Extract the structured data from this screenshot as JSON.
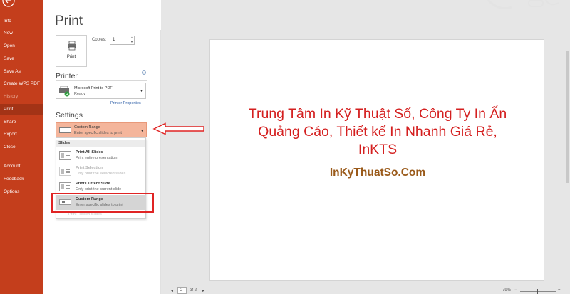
{
  "sidebar": {
    "items": [
      {
        "label": "Info",
        "state": "normal"
      },
      {
        "label": "New",
        "state": "normal"
      },
      {
        "label": "Open",
        "state": "normal"
      },
      {
        "label": "Save",
        "state": "normal"
      },
      {
        "label": "Save As",
        "state": "normal"
      },
      {
        "label": "Create WPS PDF",
        "state": "normal"
      },
      {
        "label": "History",
        "state": "dim"
      },
      {
        "label": "Print",
        "state": "selected"
      },
      {
        "label": "Share",
        "state": "normal"
      },
      {
        "label": "Export",
        "state": "normal"
      },
      {
        "label": "Close",
        "state": "normal"
      },
      {
        "label": "Account",
        "state": "normal"
      },
      {
        "label": "Feedback",
        "state": "normal"
      },
      {
        "label": "Options",
        "state": "normal"
      }
    ]
  },
  "page": {
    "title": "Print"
  },
  "print": {
    "button_label": "Print",
    "copies_label": "Copies:",
    "copies_value": "1"
  },
  "printer": {
    "heading": "Printer",
    "name": "Microsoft Print to PDF",
    "status": "Ready",
    "properties_link": "Printer Properties"
  },
  "settings": {
    "heading": "Settings",
    "selected": {
      "title": "Custom Range",
      "desc": "Enter specific slides to print"
    },
    "dropdown": {
      "header": "Slides",
      "items": [
        {
          "title": "Print All Slides",
          "desc": "Print entire presentation",
          "state": "normal"
        },
        {
          "title": "Print Selection",
          "desc": "Only print the selected slides",
          "state": "disabled"
        },
        {
          "title": "Print Current Slide",
          "desc": "Only print the current slide",
          "state": "normal"
        },
        {
          "title": "Custom Range",
          "desc": "Enter specific slides to print",
          "state": "active"
        }
      ],
      "hidden_option": "Print Hidden Slides"
    }
  },
  "preview": {
    "title": "Trung Tâm In Kỹ Thuật Số, Công Ty In Ấn Quảng Cáo, Thiết kế In Nhanh Giá Rẻ, InKTS",
    "site": "InKyThuatSo.Com"
  },
  "footer": {
    "page_current": "2",
    "page_of": "of 2",
    "zoom": "79%",
    "zoom_minus": "−",
    "zoom_plus": "+",
    "prev_arrow": "◂",
    "next_arrow": "▸"
  },
  "colors": {
    "sidebar": "#c43e1c",
    "selected_setting": "#f4b59b",
    "annotation_red": "#e02424",
    "slide_title_red": "#d41f1f",
    "slide_site_brown": "#9a5a1a"
  }
}
